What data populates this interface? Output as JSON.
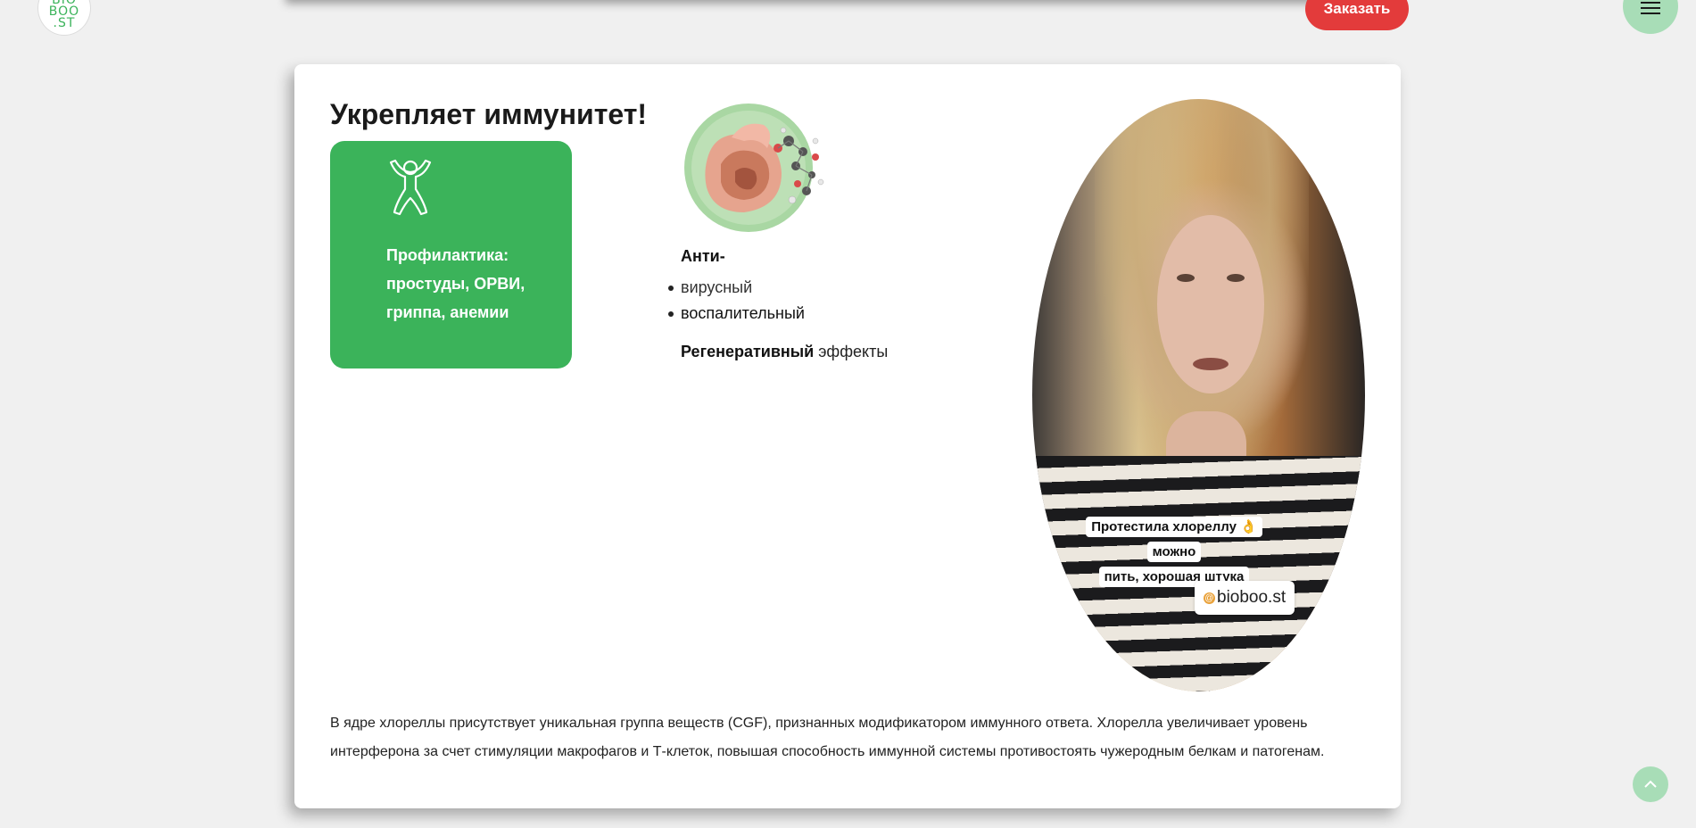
{
  "header": {
    "logo_text": "BIO\nBOO\n.ST",
    "order_button": "Заказать"
  },
  "section": {
    "title": "Укрепляет иммунитет!",
    "prevention_text": "Профилактика: простуды, ОРВИ, гриппа, анемии",
    "anti_title": "Анти-",
    "anti_items": [
      "вирусный",
      "воспалительный"
    ],
    "regen_bold": "Регенеративный",
    "regen_rest": " эффекты",
    "video": {
      "caption_line1": "Протестила хлореллу 👌 можно",
      "caption_line2": "пить, хорошая штука",
      "handle": "bioboo.st"
    },
    "description": "В ядре хлореллы присутствует уникальная группа веществ (CGF), признанных модификатором иммунного ответа. Хлорелла увеличивает уровень интерферона за счет стимуляции макрофагов и Т-клеток, повышая способность иммунной системы противостоять чужеродным белкам и патогенам."
  },
  "colors": {
    "accent_green": "#3bb35a",
    "order_red": "#e33b3b",
    "light_green": "#a8ddb7",
    "background": "#f0f0f0"
  },
  "icons": {
    "prevention": "person-icon",
    "menu": "hamburger-icon",
    "scroll_top": "chevron-up-icon"
  }
}
